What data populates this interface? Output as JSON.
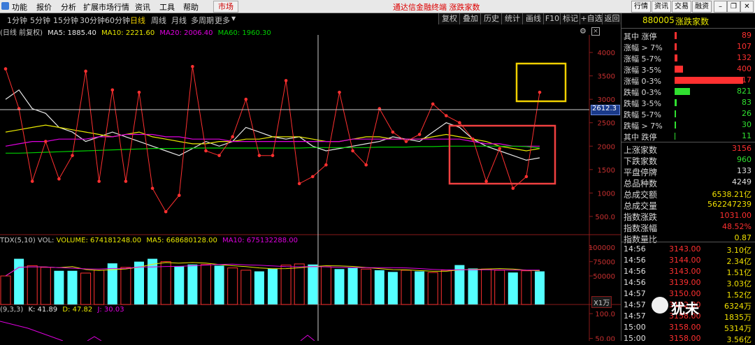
{
  "menu": [
    "功能",
    "报价",
    "分析",
    "扩展市场行情",
    "资讯",
    "工具",
    "帮助"
  ],
  "market_tag": "市场",
  "center_title": "通达信金融终端  涨跌家数",
  "top_right": [
    "行情",
    "资讯",
    "交易",
    "融资"
  ],
  "periods": [
    "1分钟",
    "5分钟",
    "15分钟",
    "30分钟",
    "60分钟",
    "日线",
    "周线",
    "月线",
    "多周期",
    "更多"
  ],
  "active_period": "日线",
  "tools": [
    "复权",
    "叠加",
    "历史",
    "统计",
    "画线",
    "F10",
    "标记",
    "+自选",
    "返回"
  ],
  "legend_ma": {
    "prefix": "(日线 前复权)",
    "ma5": "MA5: 1885.40",
    "ma10": "MA10: 2221.60",
    "ma20": "MA20: 2006.40",
    "ma60": "MA60: 1960.30"
  },
  "legend_vol": {
    "prefix": "TDX(5,10)  VOL: ",
    "volume": "VOLUME: 674181248.00",
    "ma5": "MA5: 668680128.00",
    "ma10": "MA10: 675132288.00"
  },
  "legend_kdj": {
    "prefix": "(9,3,3)",
    "k": "K: 41.89",
    "d": "D: 47.82",
    "j": "J: 30.03"
  },
  "y_axis_main": [
    "4000",
    "3500",
    "3000",
    "2500",
    "2000",
    "1500",
    "1000",
    "500.0"
  ],
  "crosshair_price": "2612.3",
  "y_axis_vol": [
    "100000",
    "75000",
    "50000"
  ],
  "vol_unit": "X1万",
  "y_axis_kdj": [
    "100.0",
    "50.00"
  ],
  "colors": {
    "up": "#ff3030",
    "down": "#2fd02f",
    "ma5": "#e8e8e8",
    "ma10": "#e8e800",
    "ma20": "#e000e0",
    "ma60": "#00d000",
    "vol_bar": "#54ffff",
    "yellow_box": "#f0d000",
    "red_box": "#f04040"
  },
  "panel": {
    "code": "880005",
    "name": "涨跌家数",
    "up_rows": [
      {
        "label": "其中 涨停",
        "value": "89"
      },
      {
        "label": "涨幅 > 7%",
        "value": "107"
      },
      {
        "label": "涨幅 5-7%",
        "value": "132"
      },
      {
        "label": "涨幅 3-5%",
        "value": "400"
      },
      {
        "label": "涨幅 0-3%",
        "value": "2517"
      }
    ],
    "down_rows": [
      {
        "label": "跌幅 0-3%",
        "value": "821"
      },
      {
        "label": "跌幅 3-5%",
        "value": "83"
      },
      {
        "label": "跌幅 5-7%",
        "value": "26"
      },
      {
        "label": "跌幅 > 7%",
        "value": "30"
      },
      {
        "label": "其中 跌停",
        "value": "11"
      }
    ],
    "stats": [
      {
        "label": "上涨家数",
        "value": "3156",
        "color": "red"
      },
      {
        "label": "下跌家数",
        "value": "960",
        "color": "green"
      },
      {
        "label": "平盘停牌",
        "value": "133",
        "color": "white"
      },
      {
        "label": "总品种数",
        "value": "4249",
        "color": "white"
      },
      {
        "label": "总成交额",
        "value": "6538.21亿",
        "color": "yellow"
      },
      {
        "label": "总成交量",
        "value": "562247239",
        "color": "yellow"
      },
      {
        "label": "指数涨跌",
        "value": "1031.00",
        "color": "red"
      },
      {
        "label": "指数涨幅",
        "value": "48.52%",
        "color": "red"
      },
      {
        "label": "指数量比",
        "value": "0.87",
        "color": "yellow"
      }
    ],
    "ticks": [
      {
        "time": "14:56",
        "price": "3143.00",
        "amount": "3.10亿"
      },
      {
        "time": "14:56",
        "price": "3144.00",
        "amount": "2.34亿"
      },
      {
        "time": "14:56",
        "price": "3143.00",
        "amount": "1.51亿"
      },
      {
        "time": "14:56",
        "price": "3139.00",
        "amount": "3.03亿"
      },
      {
        "time": "14:57",
        "price": "3150.00",
        "amount": "1.52亿"
      },
      {
        "time": "14:57",
        "price": "3152.00",
        "amount": "6324万"
      },
      {
        "time": "14:57",
        "price": "3158.00",
        "amount": "1835万"
      },
      {
        "time": "15:00",
        "price": "3158.00",
        "amount": "5314万"
      },
      {
        "time": "15:00",
        "price": "3158.00",
        "amount": "3.56亿"
      }
    ]
  },
  "watermark": "犹未",
  "chart_data": {
    "type": "line",
    "description_series": [
      {
        "name": "涨跌家数",
        "values": [
          3650,
          2800,
          1250,
          2100,
          1300,
          1800,
          3600,
          1250,
          3200,
          1250,
          3150,
          1100,
          600,
          950,
          3700,
          1900,
          1800,
          2200,
          3000,
          1800,
          1800,
          3400,
          1200,
          1350,
          1600,
          3150,
          1900,
          1600,
          2800,
          2300,
          2100,
          2250,
          2900,
          2650,
          2500,
          2150,
          1250,
          1950,
          1100,
          1350,
          3150
        ]
      },
      {
        "name": "MA5",
        "values": [
          3000,
          3200,
          2800,
          2700,
          2400,
          2300,
          2100,
          2200,
          2300,
          2200,
          2100,
          2000,
          1900,
          1800,
          1950,
          2100,
          2000,
          2100,
          2400,
          2300,
          2200,
          2150,
          2200,
          2000,
          1900,
          1950,
          2000,
          2050,
          2100,
          2200,
          2150,
          2100,
          2300,
          2500,
          2400,
          2150,
          2000,
          1900,
          1800,
          1700,
          1750
        ]
      },
      {
        "name": "MA10",
        "values": [
          2300,
          2350,
          2400,
          2450,
          2400,
          2350,
          2300,
          2250,
          2200,
          2250,
          2300,
          2200,
          2150,
          2100,
          2050,
          2050,
          2100,
          2100,
          2150,
          2150,
          2200,
          2200,
          2200,
          2150,
          2100,
          2100,
          2150,
          2200,
          2200,
          2150,
          2150,
          2150,
          2200,
          2250,
          2200,
          2150,
          2100,
          2000,
          1950,
          1900,
          1950
        ]
      },
      {
        "name": "MA20",
        "values": [
          2000,
          2050,
          2100,
          2100,
          2150,
          2150,
          2150,
          2200,
          2200,
          2250,
          2250,
          2250,
          2200,
          2200,
          2150,
          2150,
          2150,
          2100,
          2100,
          2100,
          2100,
          2100,
          2100,
          2100,
          2100,
          2100,
          2150,
          2150,
          2150,
          2150,
          2150,
          2150,
          2150,
          2150,
          2150,
          2100,
          2050,
          2050,
          2000,
          2000,
          2000
        ]
      },
      {
        "name": "MA60",
        "values": [
          1850,
          1850,
          1860,
          1870,
          1880,
          1890,
          1900,
          1910,
          1920,
          1930,
          1940,
          1950,
          1950,
          1950,
          1960,
          1960,
          1960,
          1960,
          1960,
          1960,
          1960,
          1960,
          1960,
          1970,
          1970,
          1970,
          1970,
          1970,
          1980,
          1980,
          1980,
          1990,
          1990,
          2000,
          2000,
          2000,
          2000,
          2000,
          2000,
          1990,
          1960
        ]
      }
    ],
    "ylim": [
      200,
      4300
    ],
    "volume": [
      50000,
      80000,
      68000,
      65000,
      59000,
      59000,
      55000,
      60000,
      72000,
      65000,
      75000,
      80000,
      75000,
      67000,
      70000,
      70000,
      68000,
      64000,
      60000,
      58000,
      63000,
      69000,
      71000,
      70000,
      66000,
      62000,
      64000,
      62000,
      60000,
      57000,
      60000,
      58000,
      56000,
      60000,
      69000,
      63000,
      62000,
      60000,
      56000,
      59000,
      58000
    ],
    "volume_ylim": [
      0,
      110000
    ],
    "kdj_ylim": [
      0,
      110
    ]
  }
}
